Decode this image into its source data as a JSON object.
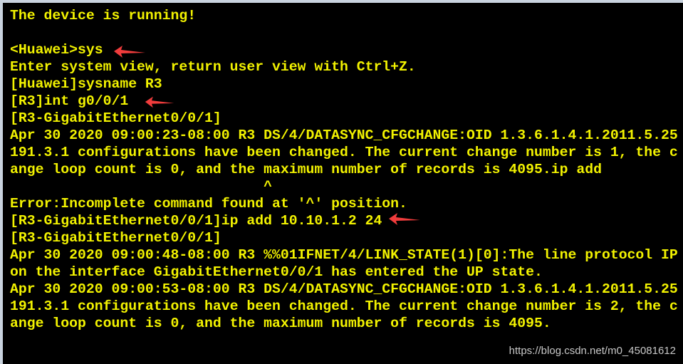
{
  "terminal": {
    "lines": [
      "The device is running!",
      "",
      "<Huawei>sys",
      "Enter system view, return user view with Ctrl+Z.",
      "[Huawei]sysname R3",
      "[R3]int g0/0/1",
      "[R3-GigabitEthernet0/0/1]",
      "Apr 30 2020 09:00:23-08:00 R3 DS/4/DATASYNC_CFGCHANGE:OID 1.3.6.1.4.1.2011.5.25",
      "191.3.1 configurations have been changed. The current change number is 1, the c",
      "ange loop count is 0, and the maximum number of records is 4095.ip add",
      "                              ^",
      "Error:Incomplete command found at '^' position.",
      "[R3-GigabitEthernet0/0/1]ip add 10.10.1.2 24",
      "[R3-GigabitEthernet0/0/1]",
      "Apr 30 2020 09:00:48-08:00 R3 %%01IFNET/4/LINK_STATE(1)[0]:The line protocol IP",
      "on the interface GigabitEthernet0/0/1 has entered the UP state.",
      "Apr 30 2020 09:00:53-08:00 R3 DS/4/DATASYNC_CFGCHANGE:OID 1.3.6.1.4.1.2011.5.25",
      "191.3.1 configurations have been changed. The current change number is 2, the c",
      "ange loop count is 0, and the maximum number of records is 4095."
    ]
  },
  "watermark": "https://blog.csdn.net/m0_45081612",
  "colors": {
    "text": "#f2f200",
    "background": "#000000",
    "arrow": "#f03c3c"
  },
  "icons": [
    "arrow-left-icon"
  ]
}
